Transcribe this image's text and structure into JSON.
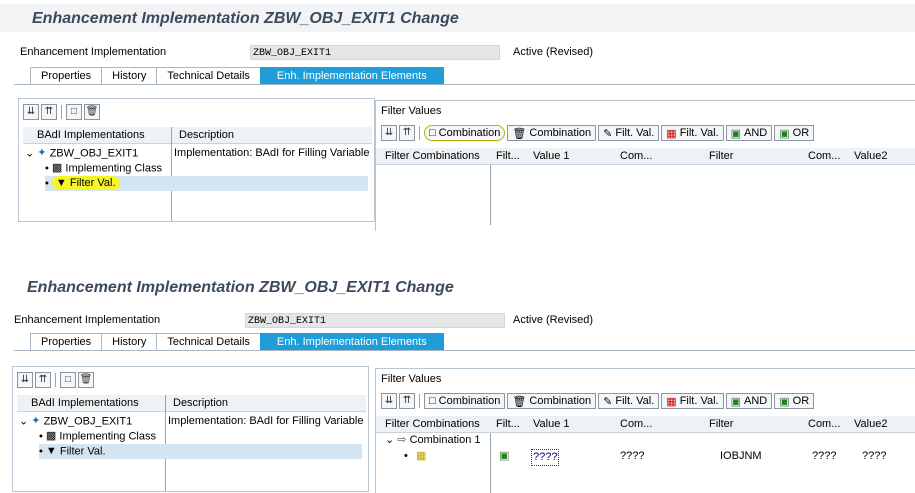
{
  "title": "Enhancement Implementation ZBW_OBJ_EXIT1 Change",
  "header": {
    "impl_label": "Enhancement Implementation",
    "impl_value": "ZBW_OBJ_EXIT1",
    "status": "Active (Revised)"
  },
  "tabs": [
    "Properties",
    "History",
    "Technical Details",
    "Enh. Implementation Elements"
  ],
  "left_tree": {
    "col_badi": "BAdI Implementations",
    "col_desc": "Description",
    "root": "ZBW_OBJ_EXIT1",
    "root_desc": "Implementation: BAdI for Filling Variable",
    "child1": "Implementing Class",
    "child2": "Filter Val."
  },
  "filter": {
    "section_label": "Filter Values",
    "toolbar": {
      "create_combination": "Combination",
      "delete_combination": "Combination",
      "change_filter": "Filt. Val.",
      "delete_filter": "Filt. Val.",
      "and": "AND",
      "or": "OR"
    },
    "columns": [
      "Filter Combinations",
      "Filt...",
      "Value 1",
      "Com...",
      "Filter",
      "Com...",
      "Value2"
    ],
    "combination_row": "Combination 1",
    "value_row": {
      "value1": "????",
      "com1": "????",
      "filter": "IOBJNM",
      "com2": "????",
      "value2": "????"
    }
  },
  "colors": {
    "active_tab": "#1f9dd9",
    "highlight": "#f5f52a",
    "selected_row": "#d4e4f1"
  },
  "icons": [
    "expand-all-icon",
    "collapse-all-icon",
    "create-icon",
    "delete-icon",
    "class-icon",
    "filter-icon",
    "edit-icon",
    "and-icon",
    "or-icon",
    "combination-icon",
    "filter-value-icon"
  ]
}
